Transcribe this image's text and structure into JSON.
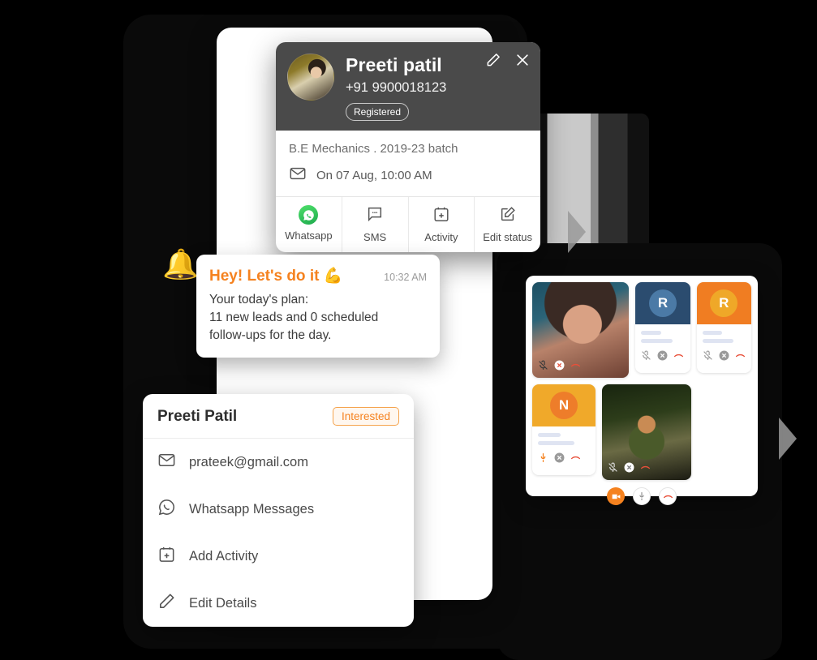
{
  "contact_card": {
    "name": "Preeti patil",
    "phone": "+91 9900018123",
    "status_badge": "Registered",
    "education": "B.E Mechanics .  2019-23 batch",
    "appointment": "On 07 Aug, 10:00 AM",
    "edit_icon": "pencil-icon",
    "close_icon": "close-icon",
    "mail_icon": "envelope-icon",
    "actions": [
      {
        "label": "Whatsapp",
        "icon": "whatsapp-icon"
      },
      {
        "label": "SMS",
        "icon": "sms-bubble-icon"
      },
      {
        "label": "Activity",
        "icon": "calendar-plus-icon"
      },
      {
        "label": "Edit status",
        "icon": "edit-square-icon"
      }
    ]
  },
  "notification": {
    "bell_icon": "bell-icon",
    "title": "Hey! Let's do it 💪",
    "time": "10:32 AM",
    "line1": "Your today's plan:",
    "line2": "11 new leads and 0 scheduled",
    "line3": "follow-ups for the day."
  },
  "lead_panel": {
    "name": "Preeti Patil",
    "badge": "Interested",
    "items": [
      {
        "label": "prateek@gmail.com",
        "icon": "envelope-icon"
      },
      {
        "label": "Whatsapp Messages",
        "icon": "whatsapp-outline-icon"
      },
      {
        "label": "Add Activity",
        "icon": "calendar-plus-icon"
      },
      {
        "label": "Edit Details",
        "icon": "pencil-icon"
      }
    ]
  },
  "video_call": {
    "tiles": [
      {
        "type": "photo",
        "initial": "",
        "mic": "muted",
        "video": "off",
        "hangup": "hangup-icon"
      },
      {
        "type": "initial",
        "initial": "R",
        "header_color": "#2b4c6f",
        "avatar_color": "#4b7aa6",
        "mic": "muted",
        "video": "off",
        "hangup": "hangup-icon"
      },
      {
        "type": "initial",
        "initial": "R",
        "header_color": "#f07d22",
        "avatar_color": "#efa828",
        "mic": "muted",
        "video": "off",
        "hangup": "hangup-icon"
      },
      {
        "type": "initial",
        "initial": "N",
        "header_color": "#f0a92a",
        "avatar_color": "#ee7d2a",
        "mic": "active",
        "video": "off",
        "hangup": "hangup-icon"
      },
      {
        "type": "photo",
        "initial": "",
        "mic": "muted",
        "video": "off",
        "hangup": "hangup-icon"
      }
    ],
    "controls": [
      {
        "icon": "video-camera-icon",
        "state": "active"
      },
      {
        "icon": "microphone-icon",
        "state": "inactive"
      },
      {
        "icon": "hangup-icon",
        "state": "inactive"
      }
    ]
  },
  "colors": {
    "accent_orange": "#f5821f",
    "whatsapp_green": "#1faa4e",
    "header_gray": "#4a4a4a",
    "hangup_red": "#e8503a"
  }
}
